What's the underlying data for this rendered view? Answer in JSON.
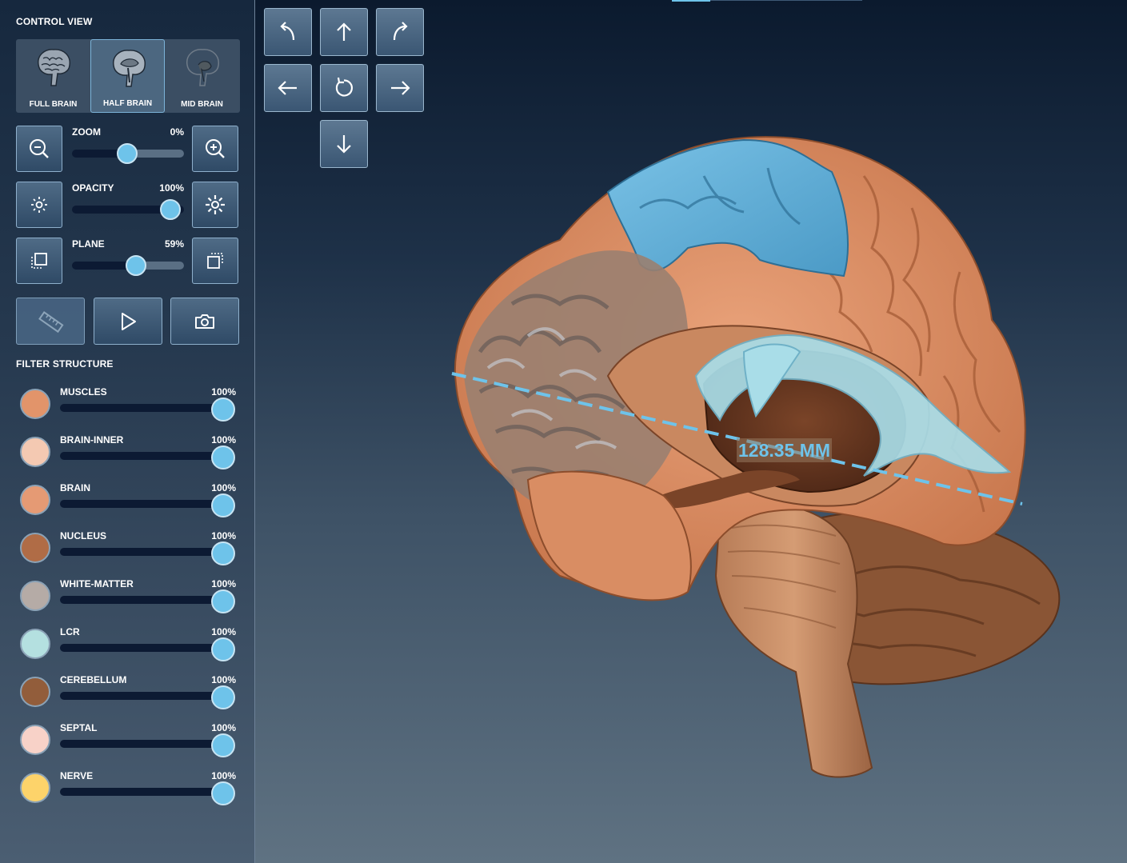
{
  "panel": {
    "control_view_title": "CONTROL VIEW",
    "view_modes": [
      {
        "label": "FULL BRAIN",
        "icon": "full-brain-icon",
        "active": false
      },
      {
        "label": "HALF BRAIN",
        "icon": "half-brain-icon",
        "active": true
      },
      {
        "label": "MID BRAIN",
        "icon": "mid-brain-icon",
        "active": false
      }
    ],
    "zoom": {
      "label": "ZOOM",
      "value_text": "0%",
      "value": 0.5,
      "minus_icon": "zoom-out-icon",
      "plus_icon": "zoom-in-icon"
    },
    "opacity": {
      "label": "OPACITY",
      "value_text": "100%",
      "value": 1.0,
      "minus_icon": "brightness-low-icon",
      "plus_icon": "brightness-high-icon"
    },
    "plane": {
      "label": "PLANE",
      "value_text": "59%",
      "value": 0.59,
      "minus_icon": "plane-back-icon",
      "plus_icon": "plane-front-icon"
    },
    "tools": [
      {
        "name": "ruler-button",
        "icon": "ruler-icon",
        "active": true
      },
      {
        "name": "play-button",
        "icon": "play-icon",
        "active": false
      },
      {
        "name": "screenshot-button",
        "icon": "camera-icon",
        "active": false
      }
    ],
    "filter_title": "FILTER STRUCTURE",
    "filters": [
      {
        "label": "MUSCLES",
        "value": "100%",
        "color": "#e2946a"
      },
      {
        "label": "BRAIN-INNER",
        "value": "100%",
        "color": "#f4c9b2"
      },
      {
        "label": "BRAIN",
        "value": "100%",
        "color": "#e59a74"
      },
      {
        "label": "NUCLEUS",
        "value": "100%",
        "color": "#b06c46"
      },
      {
        "label": "WHITE-MATTER",
        "value": "100%",
        "color": "#b5aba6"
      },
      {
        "label": "LCR",
        "value": "100%",
        "color": "#b4e0e0"
      },
      {
        "label": "CEREBELLUM",
        "value": "100%",
        "color": "#925d3b"
      },
      {
        "label": "SEPTAL",
        "value": "100%",
        "color": "#f8d2c8"
      },
      {
        "label": "NERVE",
        "value": "100%",
        "color": "#fdd36a"
      }
    ]
  },
  "navigation": {
    "buttons": [
      "rotate-up-left-icon",
      "arrow-up-icon",
      "rotate-up-right-icon",
      "arrow-left-icon",
      "reset-rotation-icon",
      "arrow-right-icon",
      "arrow-down-icon"
    ]
  },
  "viewport": {
    "measurement": "128.35 MM",
    "colors": {
      "accent": "#6ec3ea",
      "brain": "#d9875c",
      "blue_region": "#5fb0d8"
    }
  }
}
